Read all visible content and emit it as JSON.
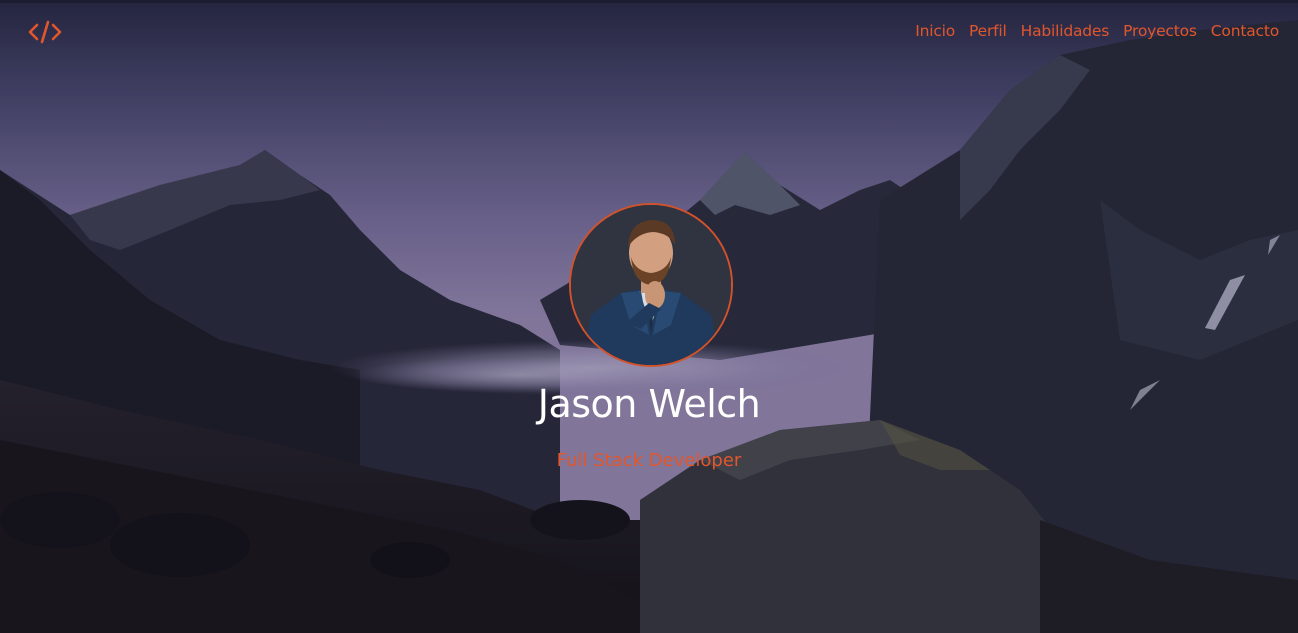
{
  "header": {
    "logo_icon": "code-brackets-icon",
    "accent_color": "#e2562c",
    "nav": [
      {
        "label": "Inicio"
      },
      {
        "label": "Perfil"
      },
      {
        "label": "Habilidades"
      },
      {
        "label": "Proyectos"
      },
      {
        "label": "Contacto"
      }
    ]
  },
  "hero": {
    "background": "mountain-landscape-at-dusk",
    "profile_photo": "man-in-suit-portrait",
    "name": "Jason Welch",
    "role": "Full Stack Developer"
  }
}
